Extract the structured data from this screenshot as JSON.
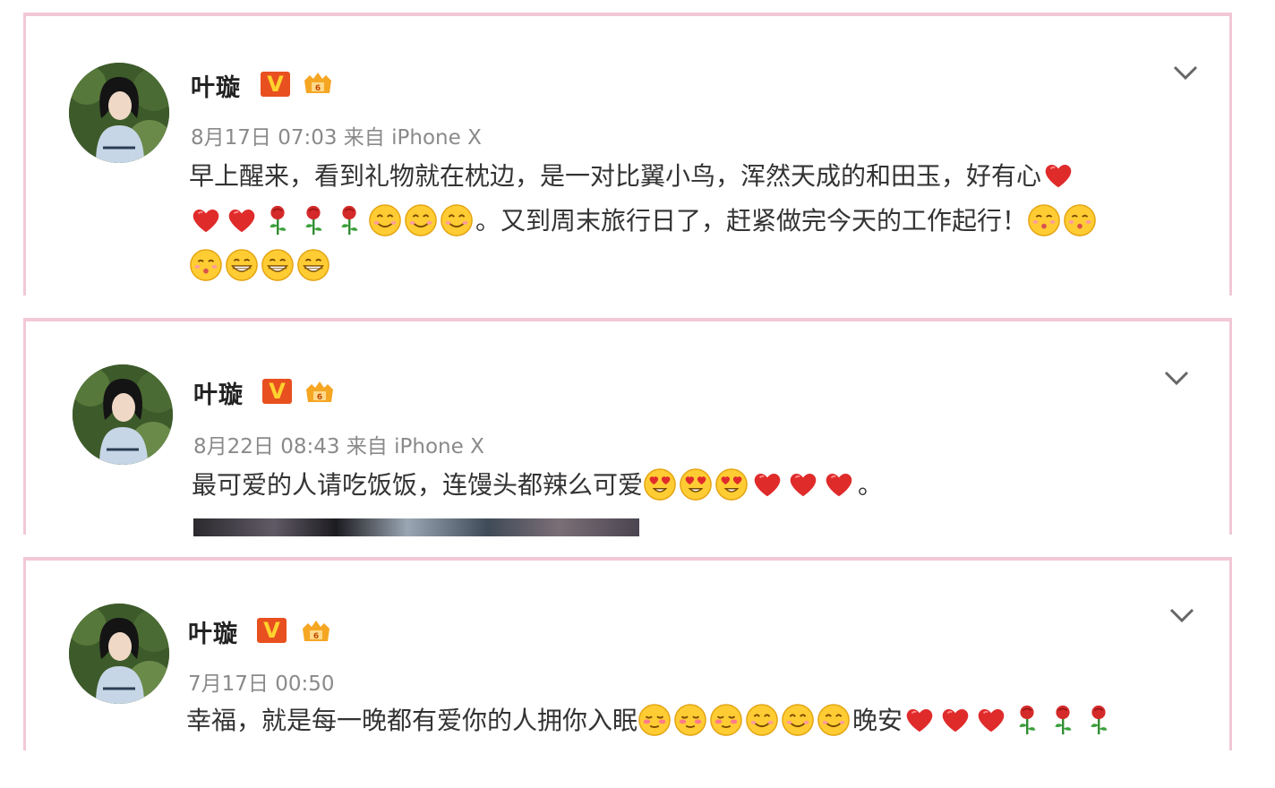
{
  "colors": {
    "card_border": "#f2c8d6",
    "verified_badge": "#e8501f",
    "meta_text": "#8a8a8a"
  },
  "posts": [
    {
      "username": "叶璇",
      "verified_label": "V",
      "member_icon": "vip-member-icon",
      "meta": "8月17日 07:03 来自 iPhone X",
      "line1": "早上醒来，看到礼物就在枕边，是一对比翼小鸟，浑然天成的和田玉，好有心",
      "line2": "。又到周末旅行日了，赶紧做完今天的工作起行！",
      "emojis": [
        "heart",
        "heart",
        "heart",
        "rose",
        "rose",
        "rose",
        "smile",
        "smile",
        "smile",
        "kiss",
        "kiss",
        "kiss",
        "grin",
        "grin",
        "grin"
      ]
    },
    {
      "username": "叶璇",
      "verified_label": "V",
      "member_icon": "vip-member-icon",
      "meta": "8月22日 08:43 来自 iPhone X",
      "line1": "最可爱的人请吃饭饭，连馒头都辣么可爱",
      "line1_end": "。",
      "emojis": [
        "heart-eyes",
        "heart-eyes",
        "heart-eyes",
        "heart",
        "heart",
        "heart"
      ]
    },
    {
      "username": "叶璇",
      "verified_label": "V",
      "member_icon": "vip-member-icon",
      "meta": "7月17日 00:50",
      "line1": "幸福，就是每一晚都有爱你的人拥你入眠",
      "line1_mid": "晚安",
      "emojis": [
        "blush",
        "blush",
        "blush",
        "smile",
        "smile",
        "smile",
        "heart",
        "heart",
        "heart",
        "rose",
        "rose",
        "rose"
      ]
    }
  ]
}
